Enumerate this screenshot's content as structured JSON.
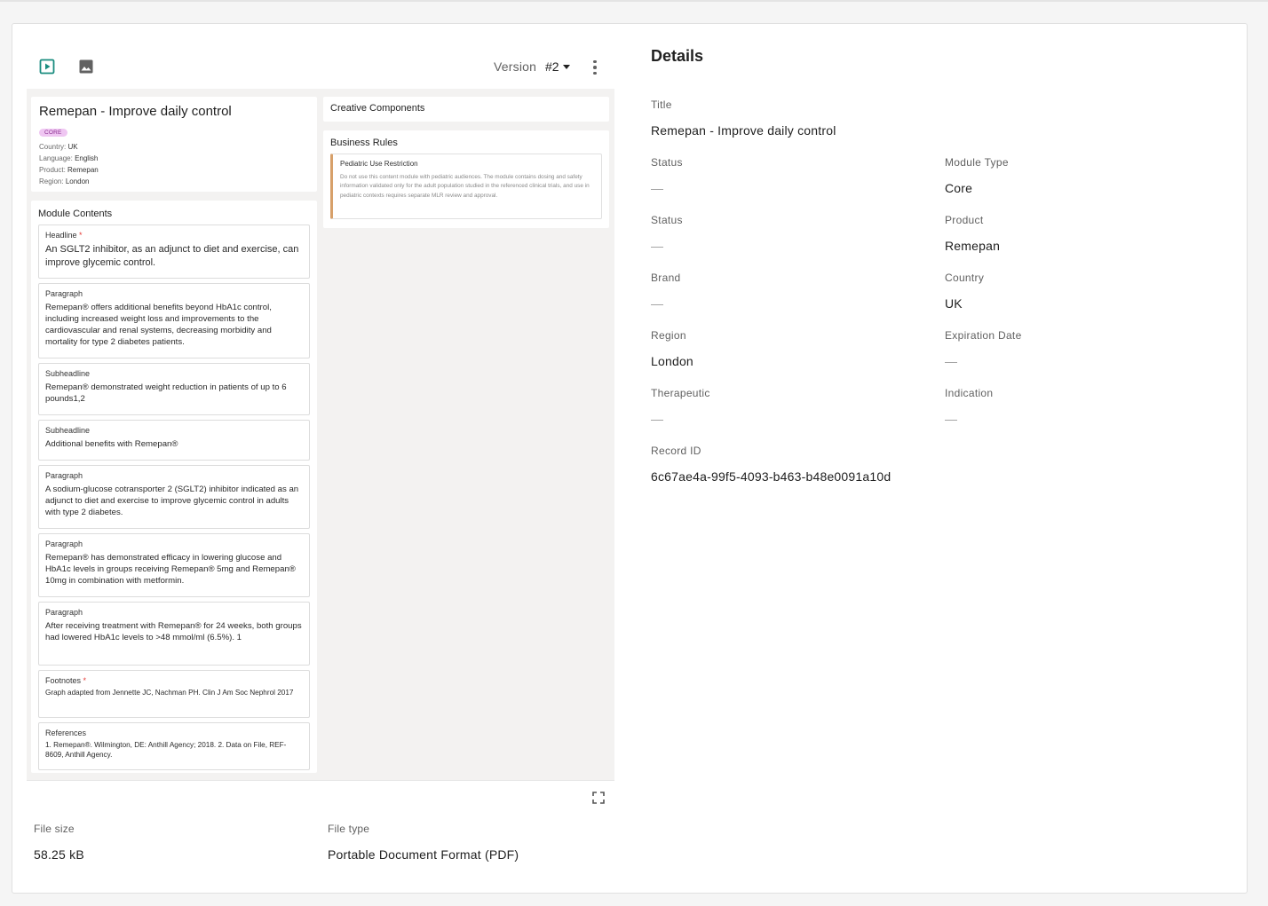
{
  "toolbar": {
    "version_label": "Version",
    "version_value": "#2"
  },
  "preview": {
    "title": "Remepan - Improve daily control",
    "badge": "CORE",
    "meta": [
      {
        "label": "Country:",
        "value": "UK"
      },
      {
        "label": "Language:",
        "value": "English"
      },
      {
        "label": "Product:",
        "value": "Remepan"
      },
      {
        "label": "Region:",
        "value": "London"
      }
    ],
    "module_contents_title": "Module Contents",
    "items": [
      {
        "label": "Headline",
        "required": "*",
        "text": "An SGLT2 inhibitor, as an adjunct to diet and exercise, can improve glycemic control."
      },
      {
        "label": "Paragraph",
        "required": "",
        "text": "Remepan® offers additional benefits beyond HbA1c control, including increased weight loss and improvements to the cardiovascular and renal systems, decreasing morbidity and mortality for type 2 diabetes patients."
      },
      {
        "label": "Subheadline",
        "required": "",
        "text": "Remepan® demonstrated weight reduction in patients of up to 6 pounds1,2"
      },
      {
        "label": "Subheadline",
        "required": "",
        "text": "Additional benefits with Remepan®"
      },
      {
        "label": "Paragraph",
        "required": "",
        "text": "A sodium-glucose cotransporter 2 (SGLT2) inhibitor indicated as an adjunct to diet and exercise to improve glycemic control in adults with type 2 diabetes."
      },
      {
        "label": "Paragraph",
        "required": "",
        "text": "Remepan® has demonstrated efficacy in lowering glucose and HbA1c levels in groups receiving Remepan® 5mg and Remepan® 10mg in combination with metformin."
      },
      {
        "label": "Paragraph",
        "required": "",
        "text": "After receiving treatment with Remepan® for 24 weeks, both groups had lowered HbA1c levels to >48 mmol/ml (6.5%). 1"
      },
      {
        "label": "Footnotes",
        "required": "*",
        "text": "Graph adapted from Jennette JC, Nachman PH. Clin J Am Soc Nephrol 2017"
      },
      {
        "label": "References",
        "required": "",
        "text": "1. Remepan®. Wilmington, DE: Anthill Agency; 2018. 2. Data on File, REF-8609, Anthill Agency."
      }
    ],
    "creative_components_title": "Creative Components",
    "business_rules_title": "Business Rules",
    "rule": {
      "title": "Pediatric Use Restriction",
      "text": "Do not use this content module with pediatric audiences. The module contains dosing and safety information validated only for the adult population studied in the referenced clinical trials, and use in pediatric contexts requires separate MLR review and approval."
    }
  },
  "file": {
    "size_label": "File size",
    "size_value": "58.25 kB",
    "type_label": "File type",
    "type_value": "Portable Document Format (PDF)"
  },
  "details": {
    "title": "Details",
    "fields": {
      "title": {
        "label": "Title",
        "value": "Remepan - Improve daily control"
      },
      "status1": {
        "label": "Status",
        "value": "—"
      },
      "module_type": {
        "label": "Module Type",
        "value": "Core"
      },
      "status2": {
        "label": "Status",
        "value": "—"
      },
      "product": {
        "label": "Product",
        "value": "Remepan"
      },
      "brand": {
        "label": "Brand",
        "value": "—"
      },
      "country": {
        "label": "Country",
        "value": "UK"
      },
      "region": {
        "label": "Region",
        "value": "London"
      },
      "expiration": {
        "label": "Expiration Date",
        "value": "—"
      },
      "therapeutic": {
        "label": "Therapeutic",
        "value": "—"
      },
      "indication": {
        "label": "Indication",
        "value": "—"
      },
      "record_id": {
        "label": "Record ID",
        "value": "6c67ae4a-99f5-4093-b463-b48e0091a10d"
      }
    }
  },
  "colors": {
    "accent": "#1a8c7f",
    "badge_bg": "#efc6f2",
    "rule_border": "#d7a06a"
  }
}
